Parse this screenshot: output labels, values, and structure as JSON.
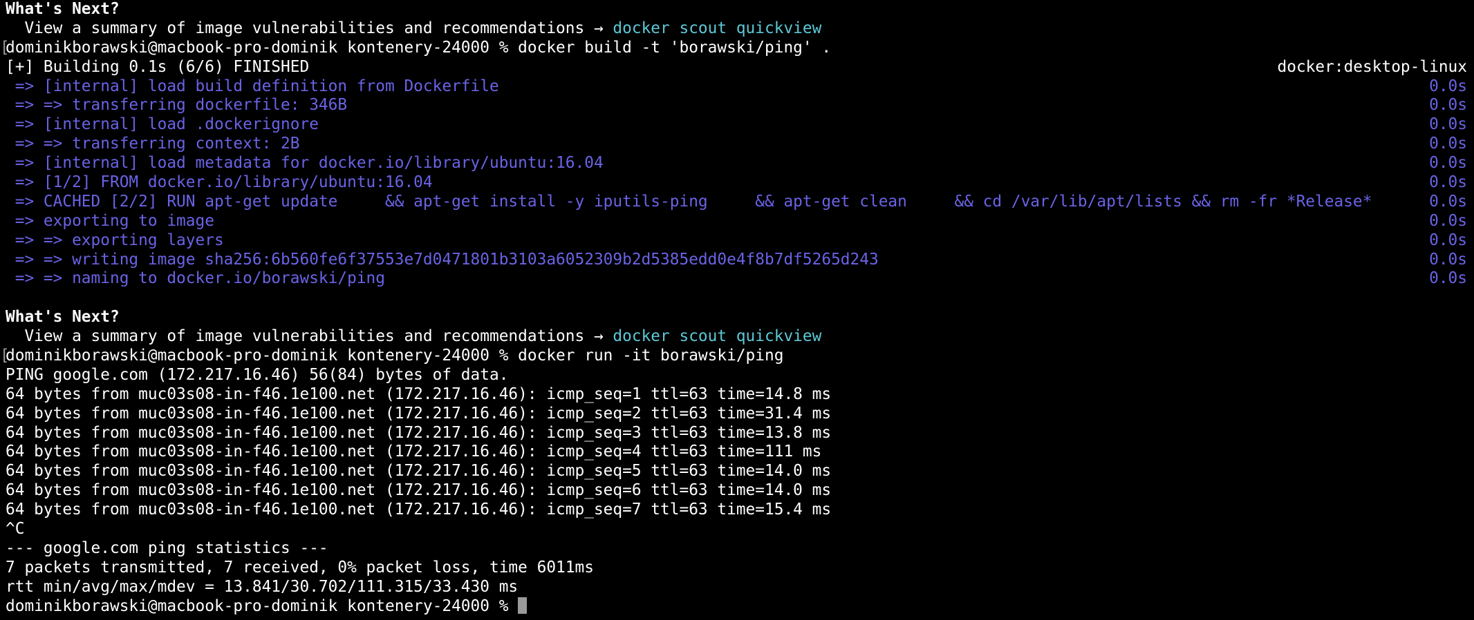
{
  "whats_next_1": {
    "heading": "What's Next?",
    "text": "  View a summary of image vulnerabilities and recommendations → ",
    "command": "docker scout quickview"
  },
  "prompt_build": {
    "bracket": "[",
    "text": "dominikborawski@macbook-pro-dominik kontenery-24000 % docker build -t 'borawski/ping' ."
  },
  "build_status": {
    "text": "[+] Building 0.1s (6/6) FINISHED",
    "context": "docker:desktop-linux"
  },
  "build_steps": [
    {
      "text": " => [internal] load build definition from Dockerfile",
      "time": "0.0s"
    },
    {
      "text": " => => transferring dockerfile: 346B",
      "time": "0.0s"
    },
    {
      "text": " => [internal] load .dockerignore",
      "time": "0.0s"
    },
    {
      "text": " => => transferring context: 2B",
      "time": "0.0s"
    },
    {
      "text": " => [internal] load metadata for docker.io/library/ubuntu:16.04",
      "time": "0.0s"
    },
    {
      "text": " => [1/2] FROM docker.io/library/ubuntu:16.04",
      "time": "0.0s"
    },
    {
      "text": " => CACHED [2/2] RUN apt-get update     && apt-get install -y iputils-ping     && apt-get clean     && cd /var/lib/apt/lists && rm -fr *Release*",
      "time": "0.0s"
    },
    {
      "text": " => exporting to image",
      "time": "0.0s"
    },
    {
      "text": " => => exporting layers",
      "time": "0.0s"
    },
    {
      "text": " => => writing image sha256:6b560fe6f37553e7d0471801b3103a6052309b2d5385edd0e4f8b7df5265d243",
      "time": "0.0s"
    },
    {
      "text": " => => naming to docker.io/borawski/ping",
      "time": "0.0s"
    }
  ],
  "whats_next_2": {
    "heading": "What's Next?",
    "text": "  View a summary of image vulnerabilities and recommendations → ",
    "command": "docker scout quickview"
  },
  "prompt_run": {
    "bracket": "[",
    "text": "dominikborawski@macbook-pro-dominik kontenery-24000 % docker run -it borawski/ping"
  },
  "ping_output": [
    "PING google.com (172.217.16.46) 56(84) bytes of data.",
    "64 bytes from muc03s08-in-f46.1e100.net (172.217.16.46): icmp_seq=1 ttl=63 time=14.8 ms",
    "64 bytes from muc03s08-in-f46.1e100.net (172.217.16.46): icmp_seq=2 ttl=63 time=31.4 ms",
    "64 bytes from muc03s08-in-f46.1e100.net (172.217.16.46): icmp_seq=3 ttl=63 time=13.8 ms",
    "64 bytes from muc03s08-in-f46.1e100.net (172.217.16.46): icmp_seq=4 ttl=63 time=111 ms",
    "64 bytes from muc03s08-in-f46.1e100.net (172.217.16.46): icmp_seq=5 ttl=63 time=14.0 ms",
    "64 bytes from muc03s08-in-f46.1e100.net (172.217.16.46): icmp_seq=6 ttl=63 time=14.0 ms",
    "64 bytes from muc03s08-in-f46.1e100.net (172.217.16.46): icmp_seq=7 ttl=63 time=15.4 ms",
    "^C",
    "--- google.com ping statistics ---",
    "7 packets transmitted, 7 received, 0% packet loss, time 6011ms",
    "rtt min/avg/max/mdev = 13.841/30.702/111.315/33.430 ms"
  ],
  "final_prompt": {
    "text": "dominikborawski@macbook-pro-dominik kontenery-24000 % "
  },
  "colors": {
    "background": "#000000",
    "foreground": "#ffffff",
    "build_step": "#6a63e6",
    "command_highlight": "#5cc8d6",
    "cursor": "#9a9a9a"
  }
}
